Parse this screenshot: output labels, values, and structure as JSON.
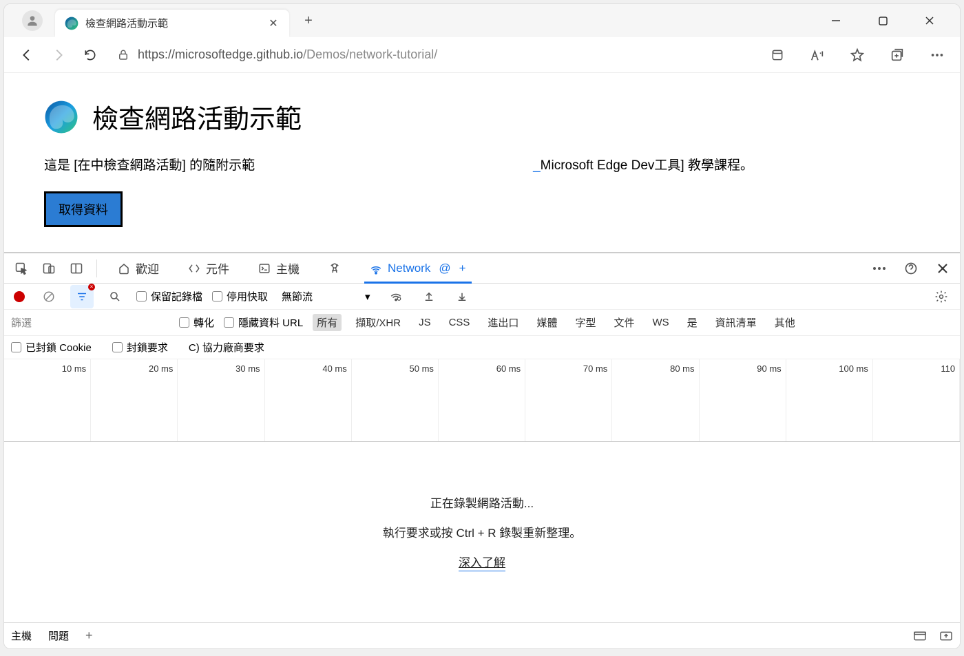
{
  "browser": {
    "tab_title": "檢查網路活動示範",
    "url_host": "https://microsoftedge.github.io",
    "url_path": "/Demos/network-tutorial/"
  },
  "page": {
    "heading": "檢查網路活動示範",
    "desc_left": "這是 [在中檢查網路活動] 的隨附示範",
    "desc_right_link": "Microsoft Edge Dev工具]",
    "desc_right_tail": " 教學課程。",
    "get_button": "取得資料"
  },
  "devtools": {
    "tabs": {
      "welcome": "歡迎",
      "elements": "元件",
      "console": "主機",
      "network": "Network",
      "tab_plus": "+",
      "tab_at": "@"
    },
    "toolbar": {
      "preserve_log": "保留記錄檔",
      "disable_cache": "停用快取",
      "throttling": "無節流"
    },
    "filter": {
      "placeholder": "篩選",
      "invert": "轉化",
      "hide_data_urls": "隱藏資料 URL",
      "types": {
        "all": "所有",
        "fetch_xhr": "擷取/XHR",
        "js": "JS",
        "css": "CSS",
        "export": "進出口",
        "media": "媒體",
        "font": "字型",
        "doc": "文件",
        "ws": "WS",
        "wasm": "是",
        "manifest": "資訊清單",
        "other": "其他"
      },
      "blocked_cookies": "已封鎖 Cookie",
      "blocked_requests": "封鎖要求",
      "third_party": "C) 協力廠商要求"
    },
    "timeline": [
      "10 ms",
      "20 ms",
      "30 ms",
      "40 ms",
      "50 ms",
      "60 ms",
      "70 ms",
      "80 ms",
      "90 ms",
      "100 ms",
      "110"
    ],
    "message": {
      "line1": "正在錄製網路活動...",
      "line2": "執行要求或按 Ctrl + R 錄製重新整理。",
      "learn_more": "深入了解"
    },
    "footer": {
      "console": "主機",
      "issues": "問題"
    }
  }
}
